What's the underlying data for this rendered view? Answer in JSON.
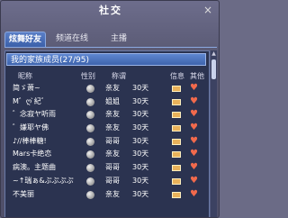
{
  "window": {
    "title": "社交",
    "close_glyph": "×"
  },
  "tabs": [
    {
      "label": "炫舞好友",
      "active": true
    },
    {
      "label": "频道在线",
      "active": false
    },
    {
      "label": "主播",
      "active": false
    }
  ],
  "group": {
    "label": "我的家族成员(27/95)"
  },
  "columns": {
    "name": "昵称",
    "gender": "性别",
    "relation": "称谓",
    "info": "信息",
    "other": "其他"
  },
  "rows": [
    {
      "name": "简ゞ萧~",
      "relation": "亲友",
      "days": "30天"
    },
    {
      "name": "M゛ღ ̀紀゛",
      "relation": "姐姐",
      "days": "30天"
    },
    {
      "name": "゛念寂ヤ听雨",
      "relation": "亲友",
      "days": "30天"
    },
    {
      "name": "゛嫌耶ヤ佛",
      "relation": "亲友",
      "days": "30天"
    },
    {
      "name": "♪//棒棒糖!",
      "relation": "哥哥",
      "days": "30天"
    },
    {
      "name": "Mars卡绝恋",
      "relation": "亲友",
      "days": "30天"
    },
    {
      "name": "病澳。主题曲",
      "relation": "哥哥",
      "days": "30天"
    },
    {
      "name": "~↑瑞ぁ&ぷぷぷぷ",
      "relation": "哥哥",
      "days": "30天"
    },
    {
      "name": "不美丽",
      "relation": "亲友",
      "days": "30天"
    }
  ],
  "colors": {
    "tab_active": "#3a5ea8",
    "panel_bg": "#2b3350",
    "group_header": "#4e74bd"
  },
  "icons": {
    "gender": "gender-ball-icon",
    "info": "mail-icon",
    "other": "heart-add-icon"
  }
}
